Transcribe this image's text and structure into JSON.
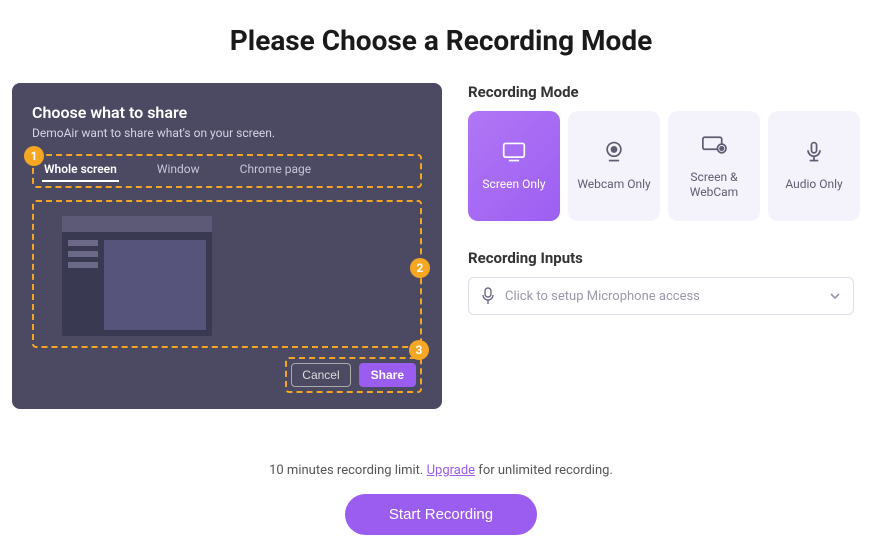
{
  "title": "Please Choose a Recording Mode",
  "share_panel": {
    "heading": "Choose what to share",
    "subtext": "DemoAir want to share what's on your screen.",
    "tabs": [
      "Whole screen",
      "Window",
      "Chrome page"
    ],
    "active_tab": 0,
    "badge1": "1",
    "badge2": "2",
    "badge3": "3",
    "cancel": "Cancel",
    "share": "Share"
  },
  "modes": {
    "section": "Recording Mode",
    "items": [
      {
        "label": "Screen Only",
        "icon": "screen-icon",
        "active": true
      },
      {
        "label": "Webcam Only",
        "icon": "webcam-icon",
        "active": false
      },
      {
        "label": "Screen & WebCam",
        "icon": "screen-webcam-icon",
        "active": false
      },
      {
        "label": "Audio Only",
        "icon": "mic-stand-icon",
        "active": false
      }
    ]
  },
  "inputs": {
    "section": "Recording Inputs",
    "placeholder": "Click to setup Microphone access"
  },
  "footer": {
    "pre": "10 minutes recording limit. ",
    "upgrade": "Upgrade",
    "post": " for unlimited recording.",
    "start": "Start Recording"
  }
}
